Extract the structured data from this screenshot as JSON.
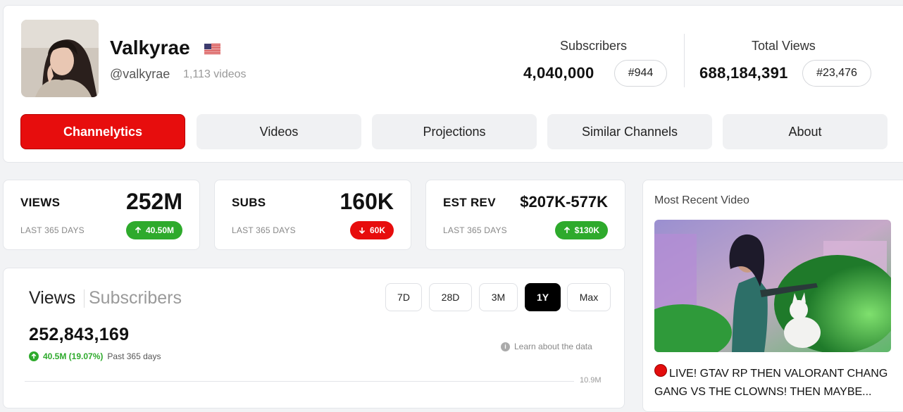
{
  "channel": {
    "name": "Valkyrae",
    "handle": "@valkyrae",
    "video_count": "1,113 videos",
    "country_flag": "us-flag-icon"
  },
  "stats": {
    "subscribers": {
      "label": "Subscribers",
      "value": "4,040,000",
      "rank": "#944"
    },
    "total_views": {
      "label": "Total Views",
      "value": "688,184,391",
      "rank": "#23,476"
    }
  },
  "tabs": [
    {
      "label": "Channelytics",
      "active": true
    },
    {
      "label": "Videos",
      "active": false
    },
    {
      "label": "Projections",
      "active": false
    },
    {
      "label": "Similar Channels",
      "active": false
    },
    {
      "label": "About",
      "active": false
    }
  ],
  "metrics": [
    {
      "label": "VIEWS",
      "value": "252M",
      "period": "LAST 365 DAYS",
      "change": "40.50M",
      "direction": "up",
      "color": "#2eaa2c"
    },
    {
      "label": "SUBS",
      "value": "160K",
      "period": "LAST 365 DAYS",
      "change": "60K",
      "direction": "down",
      "color": "#e70d0d"
    },
    {
      "label": "EST REV",
      "value": "$207K-577K",
      "period": "LAST 365 DAYS",
      "change": "$130K",
      "direction": "up",
      "color": "#2eaa2c"
    }
  ],
  "chart_panel": {
    "tab_views": "Views",
    "tab_subscribers": "Subscribers",
    "ranges": [
      "7D",
      "28D",
      "3M",
      "1Y",
      "Max"
    ],
    "active_range": "1Y",
    "total": "252,843,169",
    "growth": "40.5M (19.07%)",
    "growth_period": "Past 365 days",
    "learn_link": "Learn about the data",
    "y_tick": "10.9M"
  },
  "recent_video": {
    "heading": "Most Recent Video",
    "title": "LIVE! GTAV RP THEN VALORANT CHANG GANG VS THE CLOWNS! THEN MAYBE..."
  },
  "colors": {
    "accent_red": "#e70d0d",
    "positive_green": "#2eaa2c"
  }
}
